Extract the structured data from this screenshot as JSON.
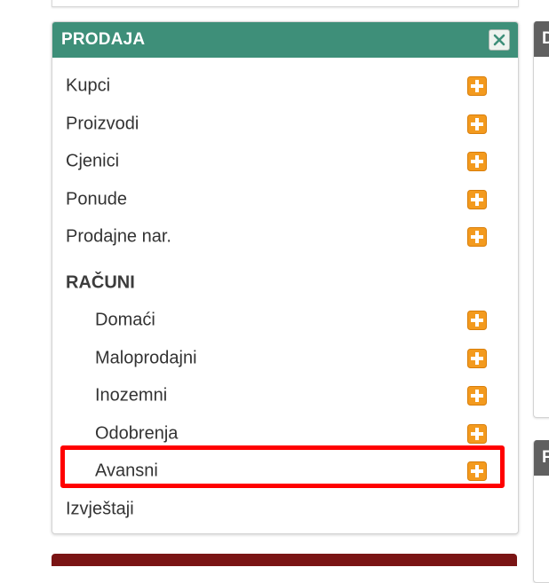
{
  "panel": {
    "title": "PRODAJA",
    "close_icon": "close-x-icon"
  },
  "menu": {
    "items": [
      {
        "label": "Kupci",
        "icon": "add-plus-icon"
      },
      {
        "label": "Proizvodi",
        "icon": "add-plus-icon"
      },
      {
        "label": "Cjenici",
        "icon": "add-plus-icon"
      },
      {
        "label": "Ponude",
        "icon": "add-plus-icon"
      },
      {
        "label": "Prodajne nar.",
        "icon": "add-plus-icon"
      }
    ],
    "section_heading": "RAČUNI",
    "sub_items": [
      {
        "label": "Domaći",
        "icon": "add-plus-icon"
      },
      {
        "label": "Maloprodajni",
        "icon": "add-plus-icon"
      },
      {
        "label": "Inozemni",
        "icon": "add-plus-icon"
      },
      {
        "label": "Odobrenja",
        "icon": "add-plus-icon"
      },
      {
        "label": "Avansni",
        "icon": "add-plus-icon",
        "highlighted": true
      }
    ],
    "footer_item": "Izvještaji"
  },
  "side_cards": [
    {
      "header_letter": "D"
    },
    {
      "header_letter": "F"
    }
  ],
  "colors": {
    "panel_header": "#3e8f79",
    "side_header": "#606060",
    "bottom_bar": "#7a1414",
    "highlight": "#ff0000",
    "plus_orange": "#f39a1e"
  }
}
